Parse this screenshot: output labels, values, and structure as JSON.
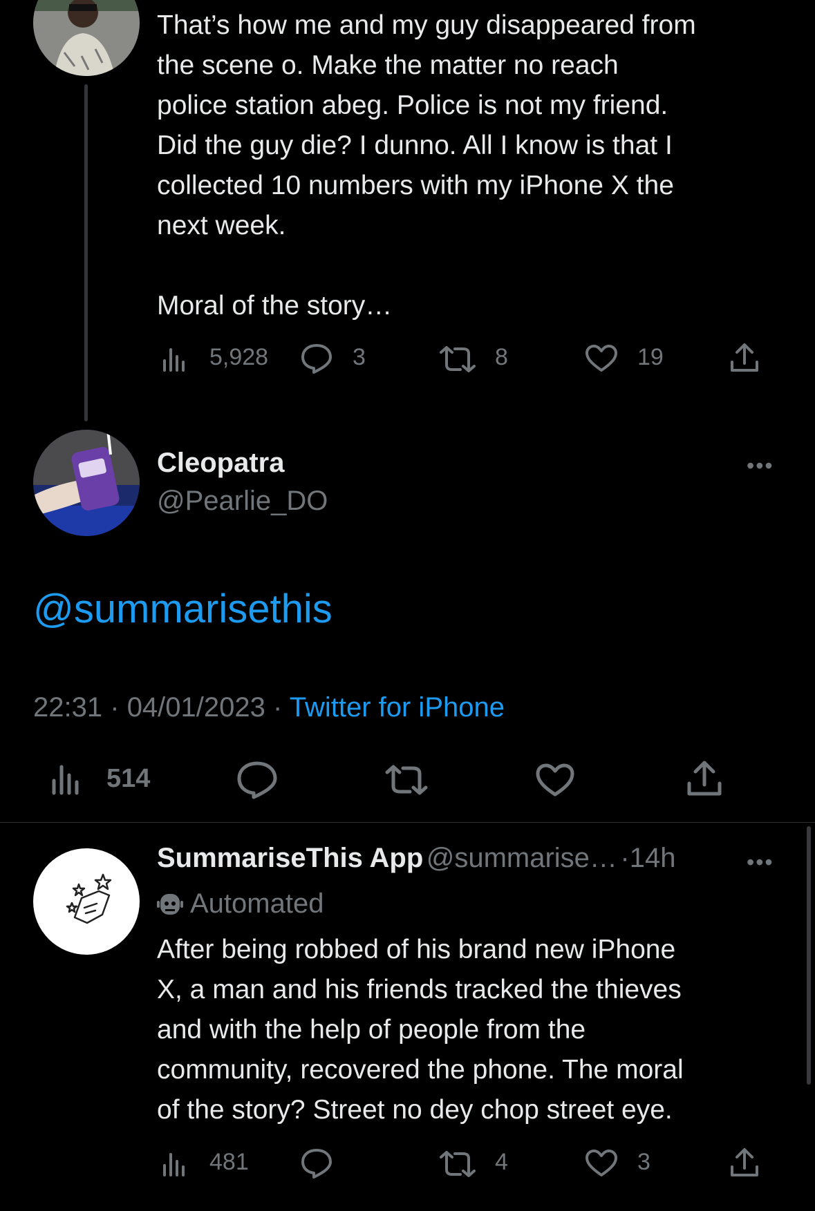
{
  "previous_tweet": {
    "body": "That’s how me and my guy disappeared from\nthe scene o. Make the matter no reach\npolice station abeg. Police is not my friend.\nDid the guy die? I dunno. All I know is that I\ncollected 10 numbers with my iPhone X the\nnext week.\n\nMoral of the story…",
    "views": "5,928",
    "replies": "3",
    "retweets": "8",
    "likes": "19"
  },
  "main_tweet": {
    "display_name": "Cleopatra",
    "handle": "@Pearlie_DO",
    "mention": "@summarisethis",
    "time": "22:31",
    "date": "04/01/2023",
    "source": "Twitter for iPhone",
    "views": "514"
  },
  "reply_tweet": {
    "display_name": "SummariseThis App",
    "handle": "@summarise…",
    "age": "14h",
    "automated_label": "Automated",
    "body": "After being robbed of his brand new iPhone\nX, a man and his friends tracked the thieves\nand with the help of people from the\ncommunity, recovered the phone. The moral\nof the story? Street no dey chop street eye.",
    "views": "481",
    "retweets": "4",
    "likes": "3"
  },
  "separator": "·",
  "more_glyph": "•••",
  "colors": {
    "background": "#000000",
    "text": "#e7e9ea",
    "muted": "#71767b",
    "link": "#1d9bf0"
  }
}
